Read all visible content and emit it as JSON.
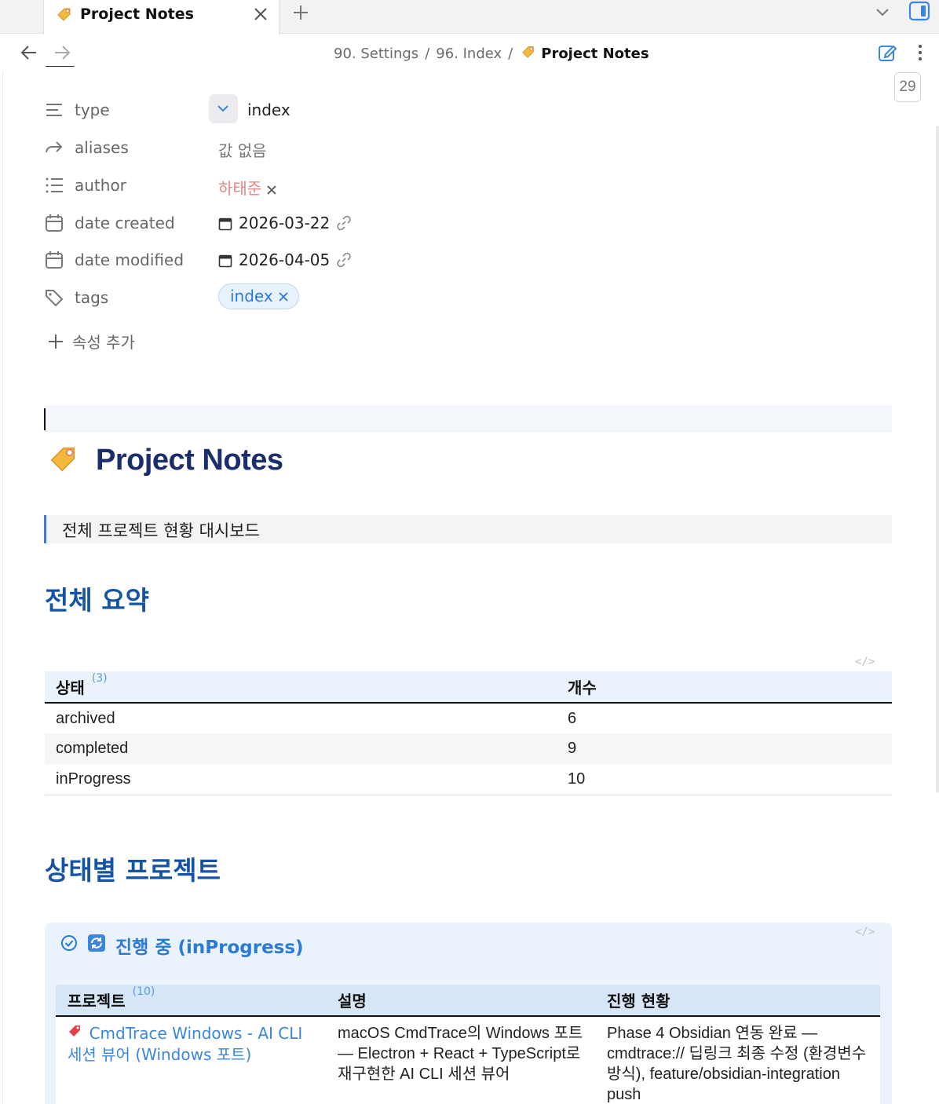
{
  "tab": {
    "title": "Project Notes"
  },
  "nav": {
    "crumb1": "90. Settings",
    "crumb2": "96. Index",
    "current": "Project Notes",
    "page_badge": "29"
  },
  "properties": {
    "type": {
      "name": "type",
      "value": "index"
    },
    "aliases": {
      "name": "aliases",
      "value": "값 없음"
    },
    "author": {
      "name": "author",
      "value": "하태준"
    },
    "date_created": {
      "name": "date created",
      "value": "2026-03-22"
    },
    "date_modified": {
      "name": "date modified",
      "value": "2026-04-05"
    },
    "tags": {
      "name": "tags",
      "value": "index"
    },
    "add_label": "속성 추가"
  },
  "note": {
    "title": "Project Notes",
    "quote": "전체 프로젝트 현황 대시보드",
    "summary_heading": "전체 요약",
    "status_heading": "상태별 프로젝트"
  },
  "summary_table": {
    "col1": "상태",
    "col1_count": "(3)",
    "col2": "개수",
    "rows": [
      {
        "status": "archived",
        "count": "6"
      },
      {
        "status": "completed",
        "count": "9"
      },
      {
        "status": "inProgress",
        "count": "10"
      }
    ]
  },
  "inprogress": {
    "title": "진행 중 (inProgress)",
    "col1": "프로젝트",
    "col1_count": "(10)",
    "col2": "설명",
    "col3": "진행 현황",
    "rows": [
      {
        "project": "CmdTrace Windows - AI CLI 세션 뷰어 (Windows 포트)",
        "desc": "macOS CmdTrace의 Windows 포트 — Electron + React + TypeScript로 재구현한 AI CLI 세션 뷰어",
        "progress": "Phase 4 Obsidian 연동 완료 — cmdtrace:// 딥링크 최종 수정 (환경변수 방식), feature/obsidian-integration push"
      }
    ]
  },
  "colors": {
    "accent": "#2a7ad6",
    "heading": "#1553a5",
    "title": "#1b2d6b",
    "author": "#e98585"
  }
}
